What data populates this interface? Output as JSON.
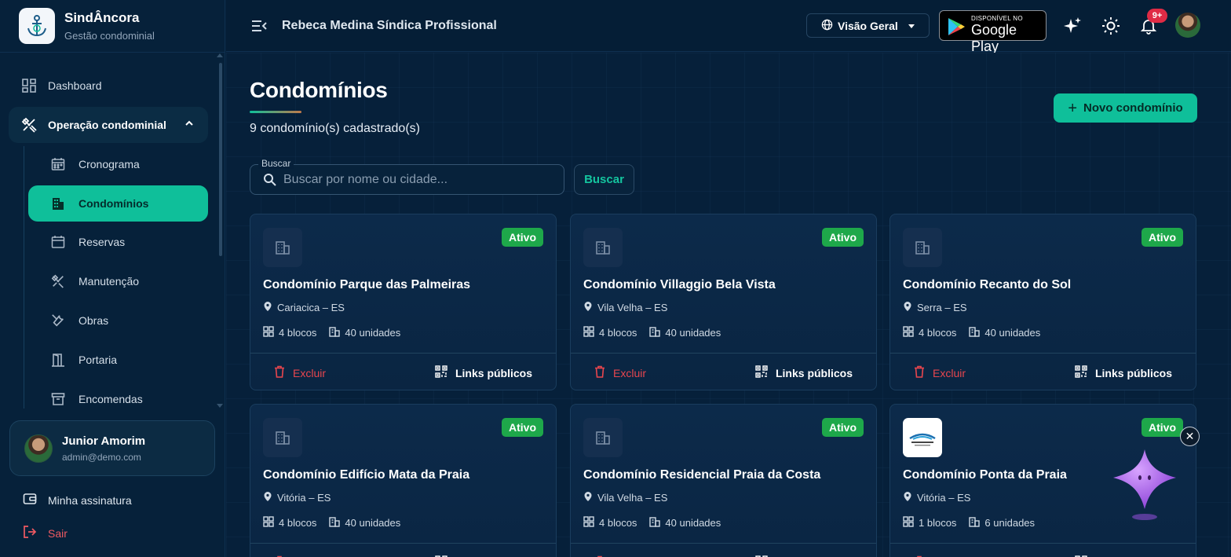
{
  "brand": {
    "name": "SindÂncora",
    "subtitle": "Gestão condominial"
  },
  "sidebar": {
    "items": [
      {
        "label": "Dashboard",
        "icon": "dashboard-icon"
      },
      {
        "label": "Operação condominial",
        "icon": "tools-icon",
        "expanded": true
      },
      {
        "label": "Cronograma",
        "icon": "calendar-icon"
      },
      {
        "label": "Condomínios",
        "icon": "building-icon",
        "active": true
      },
      {
        "label": "Reservas",
        "icon": "calendar-icon"
      },
      {
        "label": "Manutenção",
        "icon": "tools-icon"
      },
      {
        "label": "Obras",
        "icon": "wrench-icon"
      },
      {
        "label": "Portaria",
        "icon": "door-icon"
      },
      {
        "label": "Encomendas",
        "icon": "archive-icon"
      }
    ],
    "user": {
      "name": "Junior Amorim",
      "email": "admin@demo.com"
    },
    "footer": {
      "subscription": "Minha assinatura",
      "logout": "Sair"
    }
  },
  "topbar": {
    "title": "Rebeca Medina Síndica Profissional",
    "view_select": "Visão Geral",
    "gplay_small": "DISPONÍVEL NO",
    "gplay_big": "Google Play",
    "notifications_badge": "9+"
  },
  "main": {
    "title": "Condomínios",
    "subtitle": "9 condomínio(s) cadastrado(s)",
    "new_button": "Novo condomínio",
    "search": {
      "label": "Buscar",
      "placeholder": "Buscar por nome ou cidade...",
      "value": "",
      "button": "Buscar"
    },
    "card_actions": {
      "delete": "Excluir",
      "links": "Links públicos"
    },
    "cards": [
      {
        "name": "Condomínio Parque das Palmeiras",
        "location": "Cariacica – ES",
        "blocks": "4 blocos",
        "units": "40 unidades",
        "status": "Ativo"
      },
      {
        "name": "Condomínio Villaggio Bela Vista",
        "location": "Vila Velha – ES",
        "blocks": "4 blocos",
        "units": "40 unidades",
        "status": "Ativo"
      },
      {
        "name": "Condomínio Recanto do Sol",
        "location": "Serra – ES",
        "blocks": "4 blocos",
        "units": "40 unidades",
        "status": "Ativo"
      },
      {
        "name": "Condomínio Edifício Mata da Praia",
        "location": "Vitória – ES",
        "blocks": "4 blocos",
        "units": "40 unidades",
        "status": "Ativo"
      },
      {
        "name": "Condomínio Residencial Praia da Costa",
        "location": "Vila Velha – ES",
        "blocks": "4 blocos",
        "units": "40 unidades",
        "status": "Ativo"
      },
      {
        "name": "Condomínio Ponta da Praia",
        "location": "Vitória – ES",
        "blocks": "1 blocos",
        "units": "6 unidades",
        "status": "Ativo",
        "has_logo": true
      }
    ]
  },
  "colors": {
    "accent": "#0fbf9a",
    "status_active": "#1ea84a",
    "danger": "#e8464e",
    "badge": "#e02b45",
    "background": "#06203a"
  }
}
